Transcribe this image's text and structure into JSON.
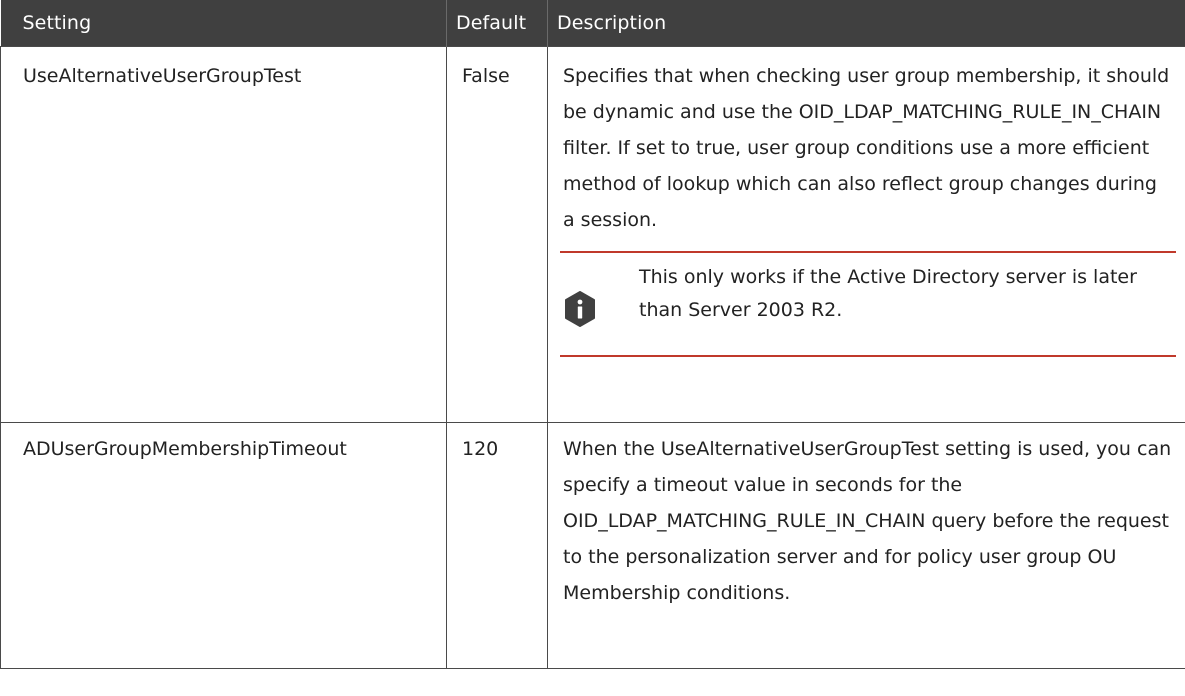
{
  "table": {
    "headers": {
      "setting": "Setting",
      "default": "Default",
      "description": "Description"
    },
    "rows": [
      {
        "setting": "UseAlternativeUserGroupTest",
        "default": "False",
        "description": "Specifies that when checking user group membership, it should be dynamic and use the OID_LDAP_MATCHING_RULE_IN_CHAIN filter. If set to true, user group conditions use a more efficient method of lookup which can also reflect group changes during a session.",
        "note": {
          "icon": "info-icon",
          "text": "This only works if the Active Directory server is later than Server 2003 R2."
        }
      },
      {
        "setting": "ADUserGroupMembershipTimeout",
        "default": "120",
        "description": "When the UseAlternativeUserGroupTest setting is used, you can specify a timeout value in seconds for the OID_LDAP_MATCHING_RULE_IN_CHAIN query before the request to the personalization server and for policy user group OU Membership conditions."
      }
    ]
  },
  "colors": {
    "header_background": "#404040",
    "header_text": "#ffffff",
    "border": "#4a4a4a",
    "note_rule": "#c0392b",
    "icon_fill": "#404040"
  }
}
